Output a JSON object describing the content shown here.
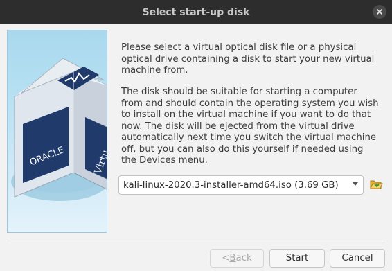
{
  "window": {
    "title": "Select start-up disk",
    "close_icon": "close-icon"
  },
  "logo": {
    "icon": "virtualbox-logo",
    "brand_text": "ORACLE",
    "side_text": "Virtu"
  },
  "description": {
    "paragraph1": "Please select a virtual optical disk file or a physical optical drive containing a disk to start your new virtual machine from.",
    "paragraph2": "The disk should be suitable for starting a computer from and should contain the operating system you wish to install on the virtual machine if you want to do that now. The disk will be ejected from the virtual drive automatically next time you switch the virtual machine off, but you can also do this yourself if needed using the Devices menu."
  },
  "disk_select": {
    "selected_value": "kali-linux-2020.3-installer-amd64.iso (3.69 GB)",
    "browse_icon": "folder-open-icon"
  },
  "buttons": {
    "back_label_prefix": "< ",
    "back_label_mnemonic": "B",
    "back_label_rest": "ack",
    "start_label": "Start",
    "cancel_label": "Cancel"
  },
  "colors": {
    "titlebar": "#2d2d2d",
    "background": "#f2f2f2",
    "logo_sky": "#b8e1f3"
  }
}
